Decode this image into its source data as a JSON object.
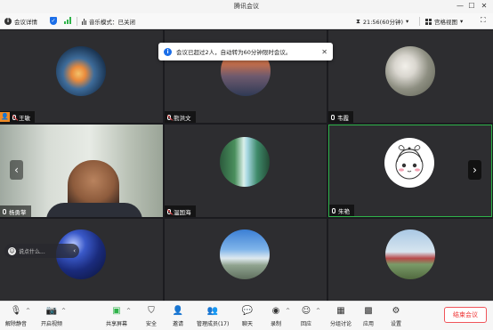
{
  "window": {
    "title": "腾讯会议",
    "min_label": "—",
    "max_label": "☐",
    "close_label": "✕"
  },
  "infobar": {
    "meeting_details": "会议详情",
    "info_icon_glyph": "i",
    "shield_glyph": "✓",
    "music_mode": "音乐模式：已关闭",
    "timer": "21:56(60分钟)",
    "view_mode": "宫格视图",
    "caret": "▾",
    "fullscreen_glyph": "⛶"
  },
  "notice": {
    "text": "会议已超过2人，自动转为60分钟限时会议。",
    "icon_glyph": "i",
    "close_glyph": "✕"
  },
  "participants": [
    {
      "name": "王敏",
      "host": true,
      "host_glyph": "👤"
    },
    {
      "name": "熊洪文"
    },
    {
      "name": "韦霞"
    },
    {
      "name": "杨勇擎"
    },
    {
      "name": "温国海"
    },
    {
      "name": "朱艳"
    }
  ],
  "nav": {
    "prev_glyph": "‹",
    "next_glyph": "›"
  },
  "chat": {
    "placeholder": "说点什么...",
    "smile_glyph": "☺",
    "back_glyph": "‹"
  },
  "toolbar": {
    "caret": "^",
    "items": [
      {
        "label": "解除静音",
        "icon": "mic-off-icon",
        "glyph": "🎙"
      },
      {
        "label": "开启视频",
        "icon": "video-off-icon",
        "glyph": "📷"
      },
      {
        "label": "共享屏幕",
        "icon": "share-screen-icon",
        "glyph": "▣"
      },
      {
        "label": "安全",
        "icon": "shield-icon",
        "glyph": "⛉"
      },
      {
        "label": "邀请",
        "icon": "invite-icon",
        "glyph": "👤"
      },
      {
        "label": "管理成员(17)",
        "icon": "members-icon",
        "glyph": "👥"
      },
      {
        "label": "聊天",
        "icon": "chat-icon",
        "glyph": "💬"
      },
      {
        "label": "录制",
        "icon": "record-icon",
        "glyph": "◉"
      },
      {
        "label": "回应",
        "icon": "react-icon",
        "glyph": "☺"
      },
      {
        "label": "分组讨论",
        "icon": "breakout-icon",
        "glyph": "▦"
      },
      {
        "label": "应用",
        "icon": "apps-icon",
        "glyph": "▩"
      },
      {
        "label": "设置",
        "icon": "settings-icon",
        "glyph": "⚙"
      }
    ],
    "end_meeting": "结束会议"
  },
  "colors": {
    "accent": "#1b6ee8",
    "active_border": "#2fb34a",
    "host_badge": "#f08a24",
    "end_red": "#e33333"
  }
}
